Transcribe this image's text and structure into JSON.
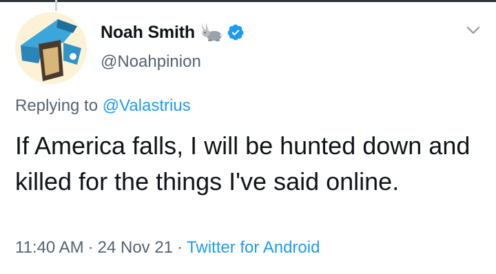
{
  "author": {
    "display_name": "Noah Smith",
    "handle": "@Noahpinion",
    "name_emoji": "rabbit-icon",
    "verified": true
  },
  "reply": {
    "prefix": "Replying to ",
    "mention": "@Valastrius"
  },
  "tweet": {
    "text": "If America falls, I will be hunted down and killed for the things I've said online."
  },
  "meta": {
    "time": "11:40 AM",
    "separator": "·",
    "date": "24 Nov 21",
    "source": "Twitter for Android"
  },
  "colors": {
    "accent": "#1d9bf0",
    "text_primary": "#0f1419",
    "text_secondary": "#536471"
  }
}
